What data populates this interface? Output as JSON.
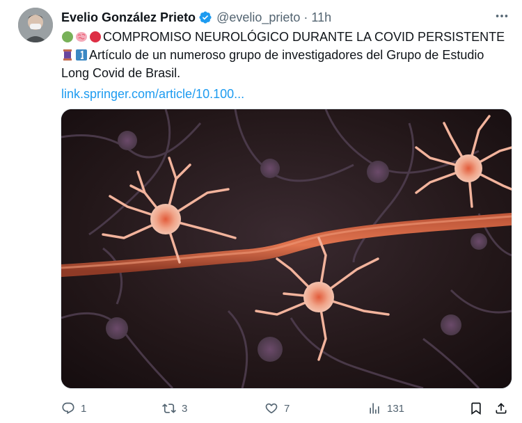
{
  "tweet": {
    "author_name": "Evelio González Prieto",
    "handle": "@evelio_prieto",
    "separator": "·",
    "time": "11h",
    "line1": "COMPROMISO NEUROLÓGICO DURANTE LA COVID PERSISTENTE",
    "line2": "Artículo de un numeroso grupo de investigadores del Grupo de Estudio",
    "line3": "Long Covid de Brasil.",
    "link": "link.springer.com/article/10.100...",
    "emoji_row1": [
      "green-circle",
      "brain",
      "red-circle"
    ],
    "emoji_row2": [
      "thread-spool",
      "keycap-1"
    ]
  },
  "actions": {
    "replies": "1",
    "retweets": "3",
    "likes": "7",
    "views": "131"
  },
  "colors": {
    "text": "#0f1419",
    "muted": "#536471",
    "link": "#1d9bf0",
    "verified": "#1d9bf0"
  }
}
